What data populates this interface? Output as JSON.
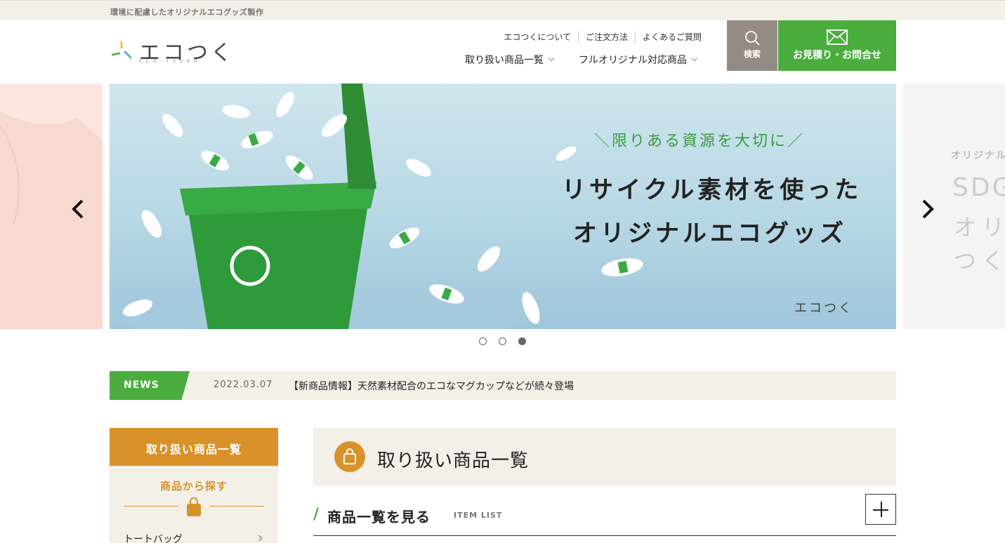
{
  "topbar": {
    "tagline": "環境に配慮したオリジナルエコグッズ製作"
  },
  "logo": {
    "text": "エコつく",
    "subtext": "ECO-TSUKU"
  },
  "subnav": [
    {
      "label": "エコつくについて"
    },
    {
      "label": "ご注文方法"
    },
    {
      "label": "よくあるご質問"
    }
  ],
  "mainnav": [
    {
      "label": "取り扱い商品一覧"
    },
    {
      "label": "フルオリジナル対応商品"
    }
  ],
  "search_button": {
    "label": "検索"
  },
  "contact_button": {
    "label": "お見積り・お問合せ"
  },
  "hero": {
    "tagline": "＼限りある資源を大切に／",
    "headline_1": "リサイクル素材を使った",
    "headline_2": "オリジナルエコグッズ",
    "brand": "エコつく"
  },
  "slide_next": {
    "line1": "オリジナル",
    "line2": "SDG",
    "line3": "オリ",
    "line4": "つく"
  },
  "carousel": {
    "dots": 3,
    "active_index": 2
  },
  "news": {
    "label": "NEWS",
    "date": "2022.03.07",
    "text": "【新商品情報】天然素材配合のエコなマグカップなどが続々登場"
  },
  "sidebar": {
    "heading": "取り扱い商品一覧",
    "subheading": "商品から探す",
    "items": [
      {
        "label": "トートバッグ"
      }
    ]
  },
  "section": {
    "title": "取り扱い商品一覧"
  },
  "item_list": {
    "title": "商品一覧を見る",
    "en": "ITEM LIST"
  },
  "colors": {
    "green": "#4aad3e",
    "orange": "#d9922a",
    "beige": "#f3f0e8",
    "gray": "#958b85"
  }
}
